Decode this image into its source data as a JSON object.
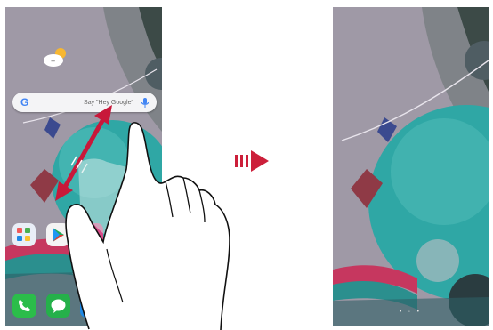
{
  "search": {
    "g_letter": "G",
    "hint": "Say \"Hey Google\""
  },
  "left_screen": {
    "page_dots": "• ◦ •",
    "dock_page_dots": ""
  },
  "right_screen": {
    "page_dots": "• ◦ •"
  },
  "colors": {
    "wallpaper": "#9f99a6",
    "teal_sphere": "#2fa7a5",
    "gesture_arrow": "#c8183a",
    "transition_arrow": "#cc1f3a",
    "phone_app": "#2bbd4a",
    "messages_app": "#25b04a",
    "camera_app": "#1e88e5",
    "gallery_app": "#6c4db3"
  },
  "icons": [
    "weather-icon",
    "mic-icon",
    "folder-icon",
    "play-store-icon",
    "phone-icon",
    "messages-icon",
    "camera-icon",
    "gallery-icon",
    "pinch-arrow-icon",
    "next-arrow-icon",
    "hand-icon"
  ]
}
